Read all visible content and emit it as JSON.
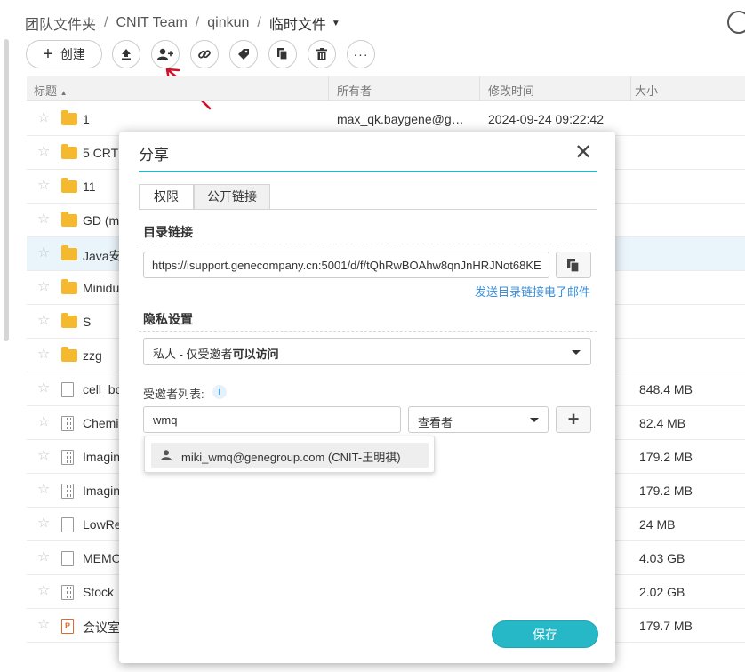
{
  "breadcrumb": {
    "items": [
      "团队文件夹",
      "CNIT Team",
      "qinkun"
    ],
    "current": "临时文件"
  },
  "toolbar": {
    "create_label": "创建"
  },
  "table": {
    "headers": {
      "title": "标题",
      "owner": "所有者",
      "mtime": "修改时间",
      "size": "大小"
    },
    "rows": [
      {
        "type": "folder",
        "name": "1",
        "owner": "max_qk.baygene@g…",
        "mtime": "2024-09-24 09:22:42",
        "size": ""
      },
      {
        "type": "folder",
        "name": "5 CRT",
        "owner": "",
        "mtime": "",
        "size": ""
      },
      {
        "type": "folder",
        "name": "11",
        "owner": "",
        "mtime": "",
        "size": ""
      },
      {
        "type": "folder",
        "name": "GD (m",
        "owner": "",
        "mtime": "",
        "size": ""
      },
      {
        "type": "folder",
        "name": "Java安",
        "owner": "",
        "mtime": "",
        "size": ""
      },
      {
        "type": "folder",
        "name": "Minidu",
        "owner": "",
        "mtime": "",
        "size": ""
      },
      {
        "type": "folder",
        "name": "S",
        "owner": "",
        "mtime": "",
        "size": ""
      },
      {
        "type": "folder",
        "name": "zzg",
        "owner": "",
        "mtime": "",
        "size": ""
      },
      {
        "type": "doc",
        "name": "cell_bc",
        "owner": "",
        "mtime": "",
        "size": "848.4 MB"
      },
      {
        "type": "zip",
        "name": "Chemi",
        "owner": "",
        "mtime": "",
        "size": "82.4 MB"
      },
      {
        "type": "zip",
        "name": "Imagin",
        "owner": "",
        "mtime": "",
        "size": "179.2 MB"
      },
      {
        "type": "zip",
        "name": "Imagin",
        "owner": "",
        "mtime": "",
        "size": "179.2 MB"
      },
      {
        "type": "doc",
        "name": "LowRe",
        "owner": "",
        "mtime": "",
        "size": "24 MB"
      },
      {
        "type": "doc",
        "name": "MEMO",
        "owner": "",
        "mtime": "",
        "size": "4.03 GB"
      },
      {
        "type": "zip",
        "name": "Stock",
        "owner": "",
        "mtime": "",
        "size": "2.02 GB"
      },
      {
        "type": "ppt",
        "name": "会议室",
        "owner": "",
        "mtime": "",
        "size": "179.7 MB"
      }
    ]
  },
  "dialog": {
    "title": "分享",
    "tabs": [
      "权限",
      "公开链接"
    ],
    "dir_link_title": "目录链接",
    "dir_link_value": "https://isupport.genecompany.cn:5001/d/f/tQhRwBOAhw8qnJnHRJNot68KE",
    "email_link_label": "发送目录链接电子邮件",
    "privacy_title": "隐私设置",
    "privacy_value_prefix": "私人 - 仅受邀者",
    "privacy_value_bold": "可以访问",
    "invitee_label": "受邀者列表:",
    "invitee_input_value": "wmq",
    "role_value": "查看者",
    "suggestion": "miki_wmq@genegroup.com (CNIT-王明祺)",
    "save_label": "保存"
  },
  "colors": {
    "accent": "#26b8c6",
    "link": "#3a8ed6",
    "folder": "#f5b930",
    "annotation_arrow": "#d0112b"
  }
}
